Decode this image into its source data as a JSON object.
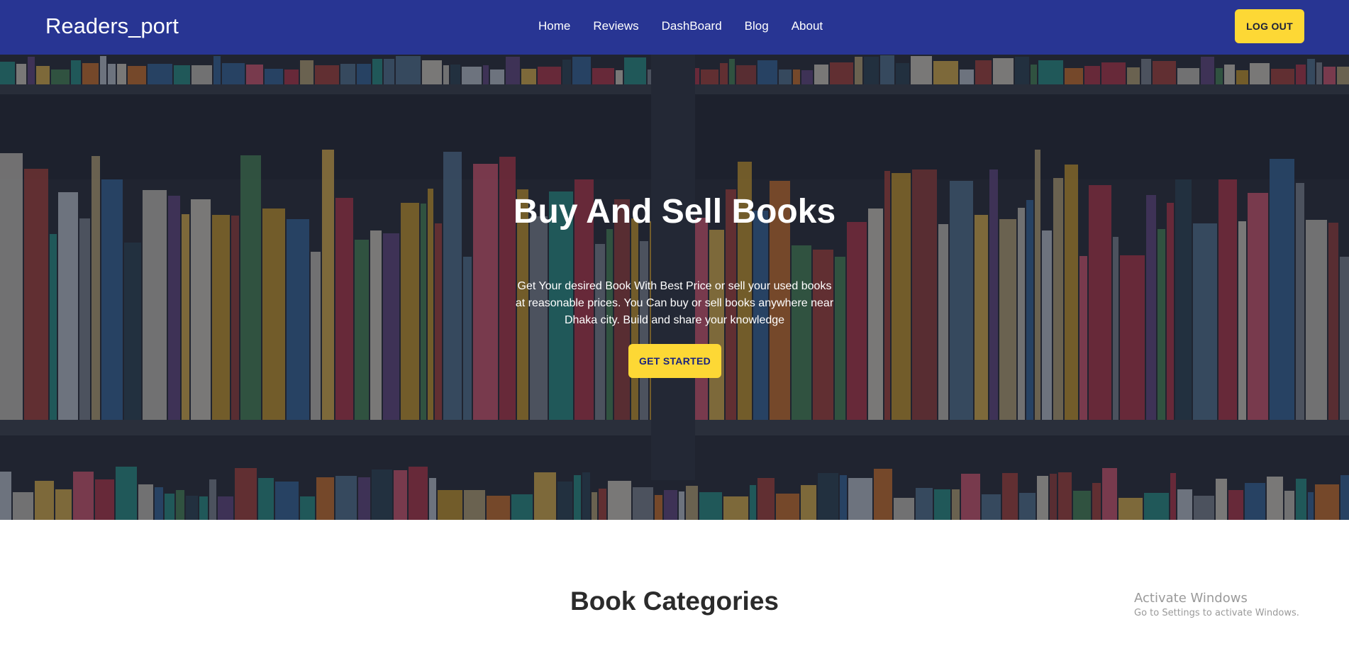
{
  "navbar": {
    "brand": "Readers_port",
    "links": [
      "Home",
      "Reviews",
      "DashBoard",
      "Blog",
      "About"
    ],
    "logout_label": "LOG OUT",
    "background_color": "#283593",
    "accent_color": "#fdd835"
  },
  "hero": {
    "title": "Buy And Sell Books",
    "description": "Get Your desired Book With Best Price or sell your used books at reasonable prices. You Can buy or sell books anywhere near Dhaka city. Build and share your knowledge",
    "cta_label": "GET STARTED"
  },
  "section": {
    "title": "Book Categories"
  },
  "watermark": {
    "title": "Activate Windows",
    "subtitle": "Go to Settings to activate Windows."
  }
}
